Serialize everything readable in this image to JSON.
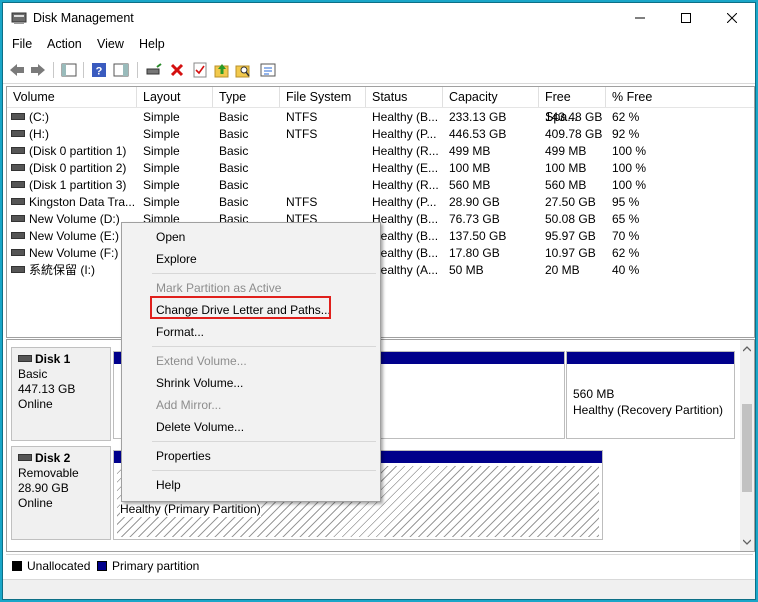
{
  "window": {
    "title": "Disk Management"
  },
  "menubar": [
    "File",
    "Action",
    "View",
    "Help"
  ],
  "columns": [
    "Volume",
    "Layout",
    "Type",
    "File System",
    "Status",
    "Capacity",
    "Free Spa...",
    "% Free"
  ],
  "volumes": [
    [
      "(C:)",
      "Simple",
      "Basic",
      "NTFS",
      "Healthy (B...",
      "233.13 GB",
      "143.48 GB",
      "62 %"
    ],
    [
      "(H:)",
      "Simple",
      "Basic",
      "NTFS",
      "Healthy (P...",
      "446.53 GB",
      "409.78 GB",
      "92 %"
    ],
    [
      "(Disk 0 partition 1)",
      "Simple",
      "Basic",
      "",
      "Healthy (R...",
      "499 MB",
      "499 MB",
      "100 %"
    ],
    [
      "(Disk 0 partition 2)",
      "Simple",
      "Basic",
      "",
      "Healthy (E...",
      "100 MB",
      "100 MB",
      "100 %"
    ],
    [
      "(Disk 1 partition 3)",
      "Simple",
      "Basic",
      "",
      "Healthy (R...",
      "560 MB",
      "560 MB",
      "100 %"
    ],
    [
      "Kingston Data Tra...",
      "Simple",
      "Basic",
      "NTFS",
      "Healthy (P...",
      "28.90 GB",
      "27.50 GB",
      "95 %"
    ],
    [
      "New Volume (D:)",
      "Simple",
      "Basic",
      "NTFS",
      "Healthy (B...",
      "76.73 GB",
      "50.08 GB",
      "65 %"
    ],
    [
      "New Volume (E:)",
      "",
      "",
      "",
      "Healthy (B...",
      "137.50 GB",
      "95.97 GB",
      "70 %"
    ],
    [
      "New Volume (F:)",
      "",
      "",
      "",
      "Healthy (B...",
      "17.80 GB",
      "10.97 GB",
      "62 %"
    ],
    [
      "系統保留 (I:)",
      "",
      "",
      "",
      "Healthy (A...",
      "50 MB",
      "20 MB",
      "40 %"
    ]
  ],
  "disks": [
    {
      "name": "Disk 1",
      "type": "Basic",
      "size": "447.13 GB",
      "state": "Online",
      "partition_size": "560 MB",
      "partition_status": "Healthy (Recovery Partition)"
    },
    {
      "name": "Disk 2",
      "type": "Removable",
      "size": "28.90 GB",
      "state": "Online",
      "partition_status": "Healthy (Primary Partition)"
    }
  ],
  "legend": {
    "unallocated": "Unallocated",
    "primary": "Primary partition"
  },
  "context_menu": {
    "open": "Open",
    "explore": "Explore",
    "mark_active": "Mark Partition as Active",
    "change_letter": "Change Drive Letter and Paths...",
    "format": "Format...",
    "extend": "Extend Volume...",
    "shrink": "Shrink Volume...",
    "add_mirror": "Add Mirror...",
    "delete": "Delete Volume...",
    "properties": "Properties",
    "help": "Help"
  },
  "colors": {
    "accent_border": "#1aa6c8",
    "partition_bar": "#00008b",
    "highlight": "#e0201c"
  }
}
